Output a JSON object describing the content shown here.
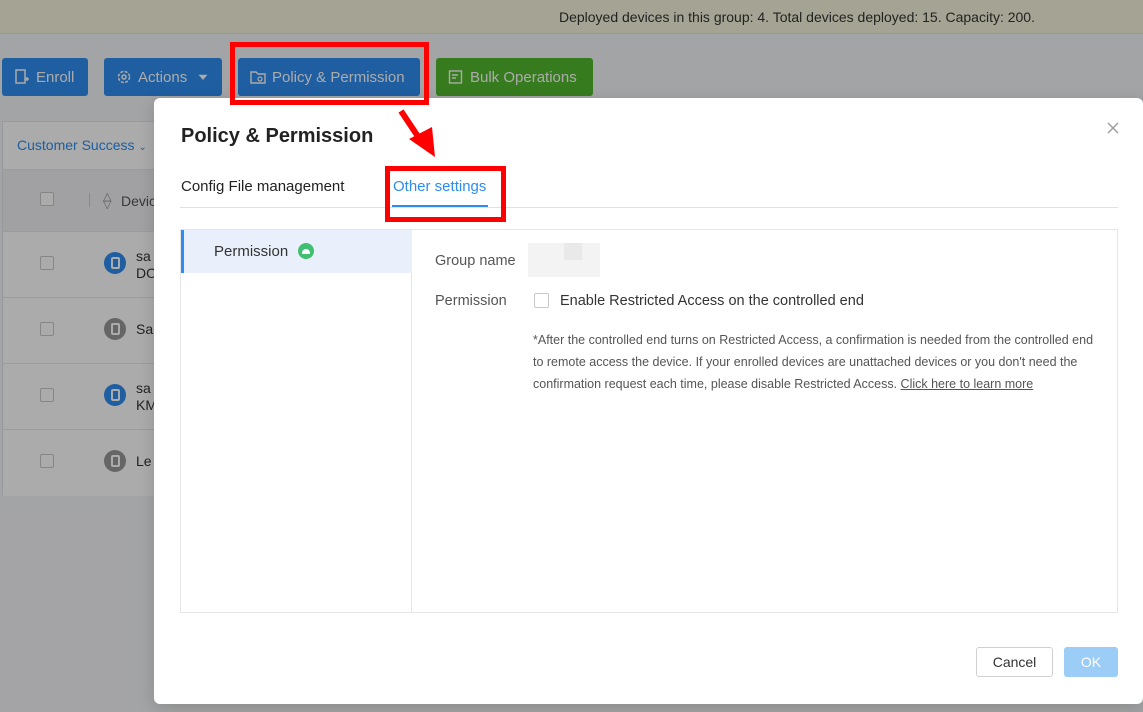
{
  "banner": {
    "text": "Deployed devices in this group: 4. Total devices deployed: 15. Capacity: 200."
  },
  "toolbar": {
    "enroll_label": "Enroll",
    "actions_label": "Actions",
    "policy_label": "Policy & Permission",
    "bulk_label": "Bulk Operations"
  },
  "filter": {
    "group_label": "Customer Success"
  },
  "table": {
    "column_header": "Devic",
    "rows": [
      {
        "line1": "sa",
        "line2": "DO",
        "icon_color": "blue"
      },
      {
        "line1": "Sa",
        "line2": "",
        "icon_color": "gray"
      },
      {
        "line1": "sa",
        "line2": "KM",
        "icon_color": "blue"
      },
      {
        "line1": "Le",
        "line2": "",
        "icon_color": "gray"
      }
    ]
  },
  "modal": {
    "title": "Policy & Permission",
    "tabs": [
      "Config File management",
      "Other settings"
    ],
    "active_tab": "Other settings",
    "sidebar_item": "Permission",
    "group_name_label": "Group name",
    "permission_label": "Permission",
    "checkbox_label": "Enable Restricted Access on the controlled end",
    "checkbox_checked": false,
    "note": "*After the controlled end turns on Restricted Access, a confirmation is needed from the controlled end to remote access the device. If your enrolled devices are unattached devices or you don't need the confirmation request each time, please disable Restricted Access. ",
    "note_link": "Click here to learn more",
    "cancel_label": "Cancel",
    "ok_label": "OK"
  },
  "colors": {
    "accent": "#2d8cf0",
    "green": "#52b82f",
    "annotation": "#ff0000"
  }
}
